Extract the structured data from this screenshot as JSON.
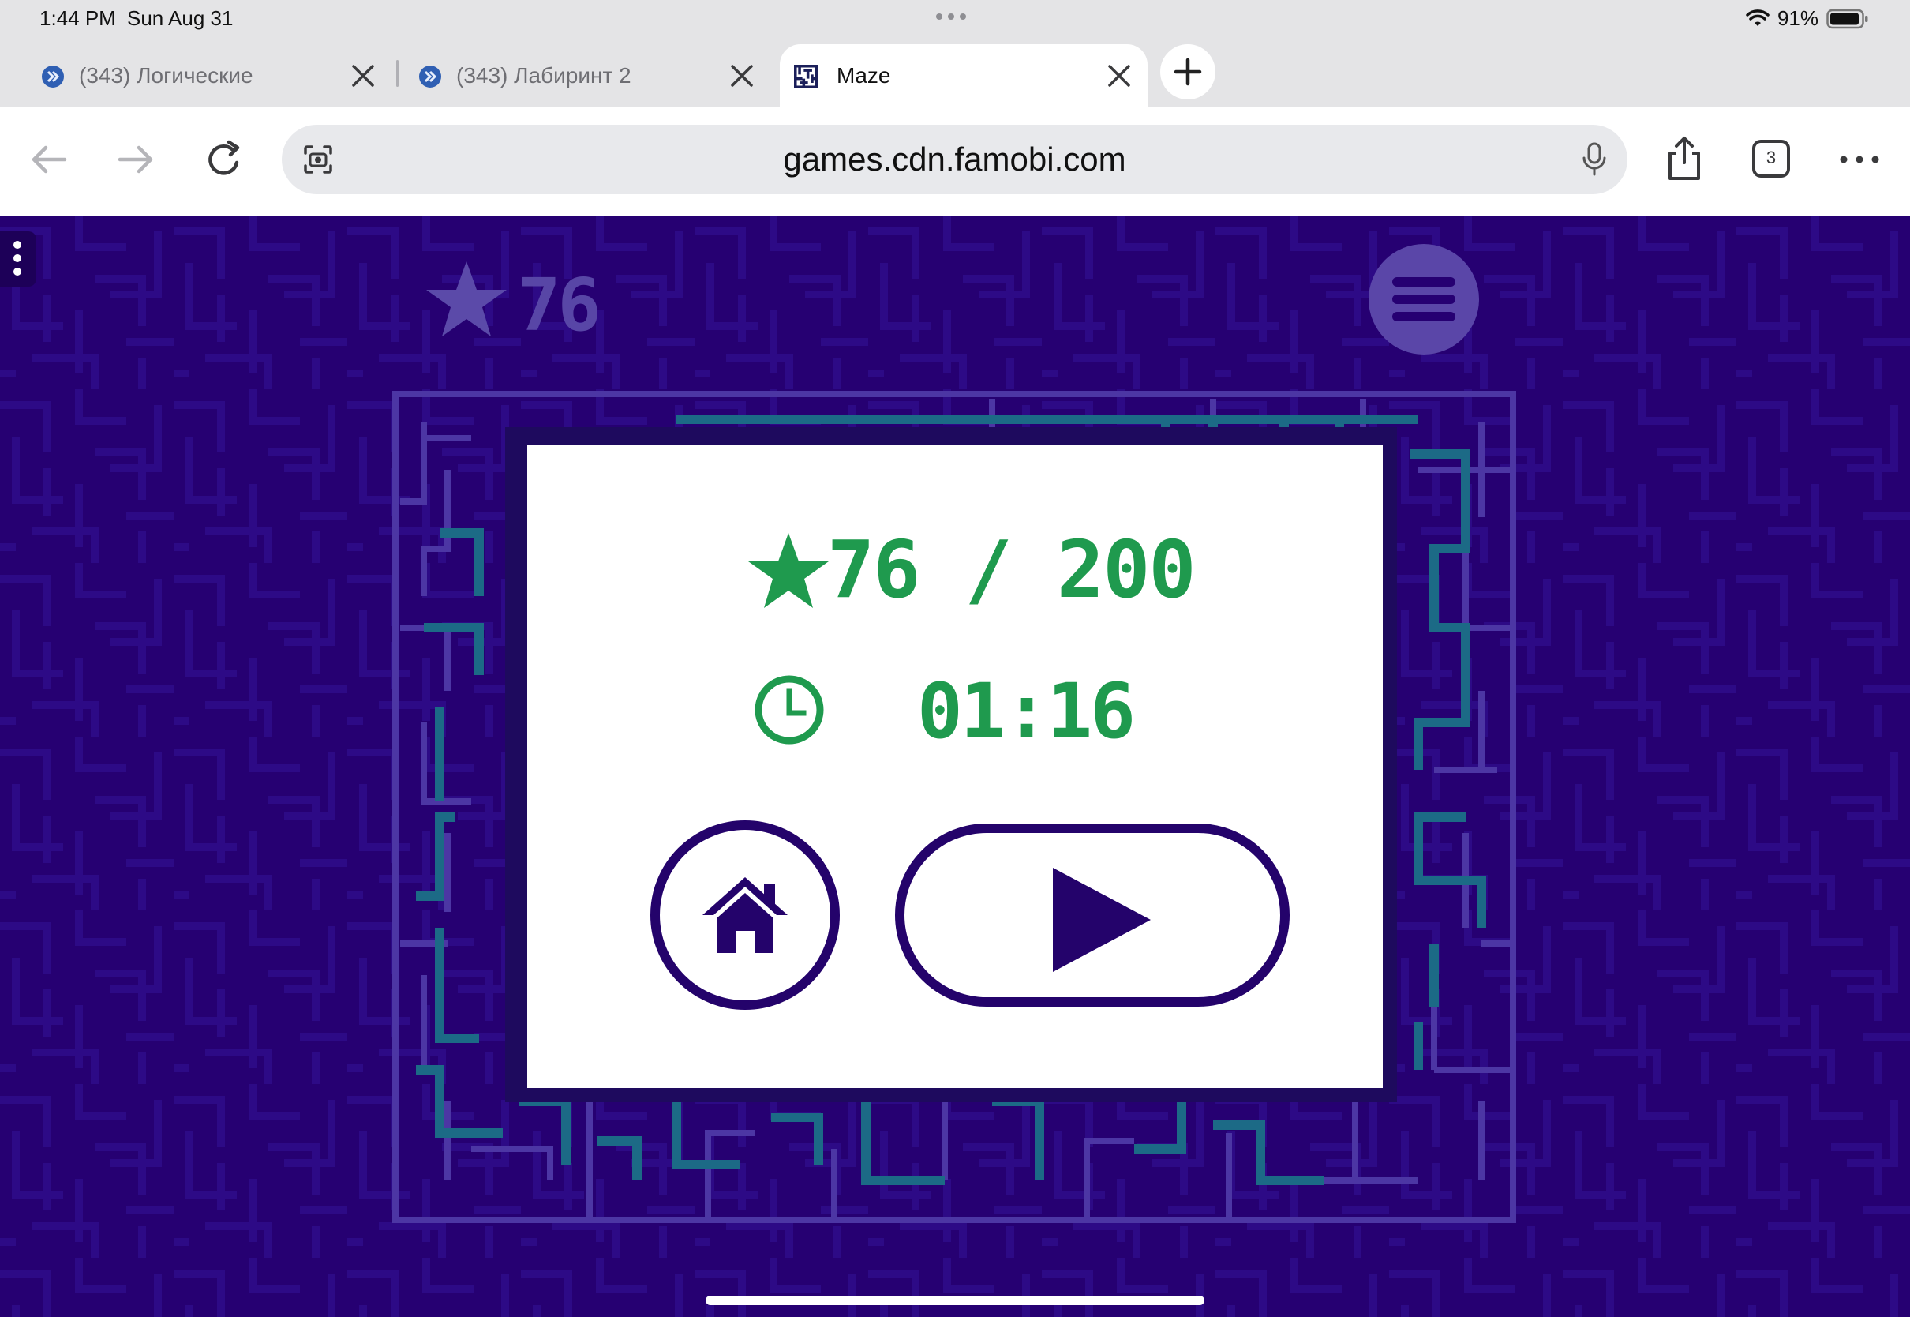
{
  "status_bar": {
    "time": "1:44 PM",
    "date": "Sun Aug 31",
    "battery": "91%"
  },
  "tabs": [
    {
      "title": "(343) Логические",
      "icon": "youtube-favicon"
    },
    {
      "title": "(343) Лабиринт 2",
      "icon": "youtube-favicon"
    },
    {
      "title": "Maze",
      "icon": "maze-favicon",
      "active": true
    }
  ],
  "toolbar": {
    "url": "games.cdn.famobi.com",
    "tab_count": "3"
  },
  "game": {
    "header_score": "76",
    "result": {
      "score": "76 / 200",
      "time": "01:16"
    }
  },
  "colors": {
    "game_background": "#260072",
    "score_green": "#1f9a4e",
    "button_navy": "#24036b",
    "maze_lines": "#4c36a4",
    "maze_path": "#1c6a86"
  }
}
